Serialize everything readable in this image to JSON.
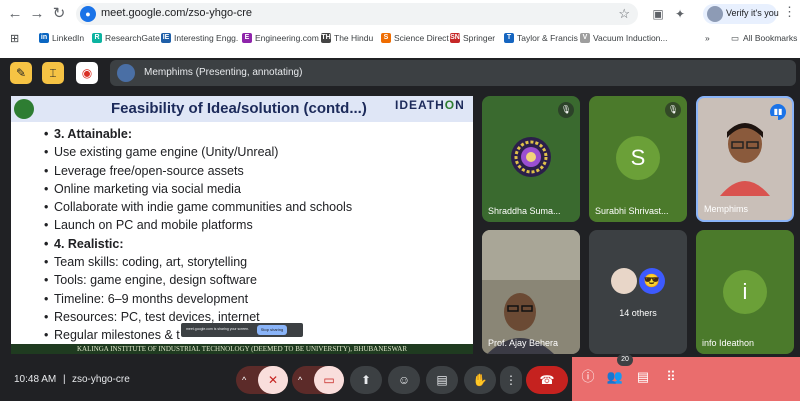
{
  "browser": {
    "url": "meet.google.com/zso-yhgo-cre",
    "profile_label": "Verify it's you",
    "bookmarks": [
      {
        "label": "LinkedIn",
        "color": "#0a66c2",
        "glyph": "in"
      },
      {
        "label": "ResearchGate",
        "color": "#0cb3a0",
        "glyph": "R"
      },
      {
        "label": "Interesting Engg.",
        "color": "#1f5fa8",
        "glyph": "IE"
      },
      {
        "label": "Engineering.com",
        "color": "#8e24aa",
        "glyph": "E"
      },
      {
        "label": "The Hindu",
        "color": "#444444",
        "glyph": "TH"
      },
      {
        "label": "Science Direct",
        "color": "#ef6c00",
        "glyph": "S"
      },
      {
        "label": "Springer",
        "color": "#c62828",
        "glyph": "SN"
      },
      {
        "label": "Taylor & Francis",
        "color": "#1565c0",
        "glyph": "T"
      },
      {
        "label": "Vacuum Induction...",
        "color": "#9e9e9e",
        "glyph": "V"
      }
    ],
    "all_bookmarks": "All Bookmarks"
  },
  "presenter_bar": {
    "label": "Memphims (Presenting, annotating)"
  },
  "slide": {
    "title": "Feasibility of Idea/solution (contd...)",
    "logo_text": "IDEATH",
    "logo_o": "O",
    "logo_end": "N",
    "items": [
      {
        "text": "3. Attainable:",
        "bold": true
      },
      {
        "text": "Use existing game engine (Unity/Unreal)",
        "bold": false
      },
      {
        "text": "Leverage free/open-source assets",
        "bold": false
      },
      {
        "text": "Online marketing via social media",
        "bold": false
      },
      {
        "text": "Collaborate with indie game communities and schools",
        "bold": false
      },
      {
        "text": "Launch on PC and mobile platforms",
        "bold": false
      },
      {
        "text": "4. Realistic:",
        "bold": true
      },
      {
        "text": "Team skills: coding, art, storytelling",
        "bold": false
      },
      {
        "text": "Tools: game engine, design software",
        "bold": false
      },
      {
        "text": "Timeline: 6–9 months development",
        "bold": false
      },
      {
        "text": "Resources: PC, test devices, internet",
        "bold": false
      },
      {
        "text": "Regular milestones & t",
        "bold": false
      }
    ],
    "footer": "KALINGA INSTITUTE OF INDUSTRIAL TECHNOLOGY (DEEMED TO BE UNIVERSITY), BHUBANESWAR",
    "share_toast": {
      "message": "meet.google.com is sharing your screen.",
      "stop_label": "Stop sharing"
    }
  },
  "participants": [
    {
      "name": "Shraddha Suma...",
      "bg": "#3a6a2f",
      "kind": "mandala"
    },
    {
      "name": "Surabhi Shrivast...",
      "bg": "#4b7a2b",
      "initial": "S",
      "kind": "initial",
      "circle": "#6ba038"
    },
    {
      "name": "Memphims",
      "bg": "#c9bfb8",
      "kind": "photo"
    },
    {
      "name": "Prof. Ajay Behera",
      "bg": "#6f6e66",
      "kind": "photo"
    },
    {
      "name": "14 others",
      "bg": "#3c4043",
      "kind": "others"
    },
    {
      "name": "info Ideathon",
      "bg": "#4b7a2b",
      "initial": "i",
      "kind": "initial",
      "circle": "#6ba038"
    }
  ],
  "bottom": {
    "time": "10:48 AM",
    "separator": "|",
    "meeting_code": "zso-yhgo-cre",
    "people_count": "20"
  }
}
